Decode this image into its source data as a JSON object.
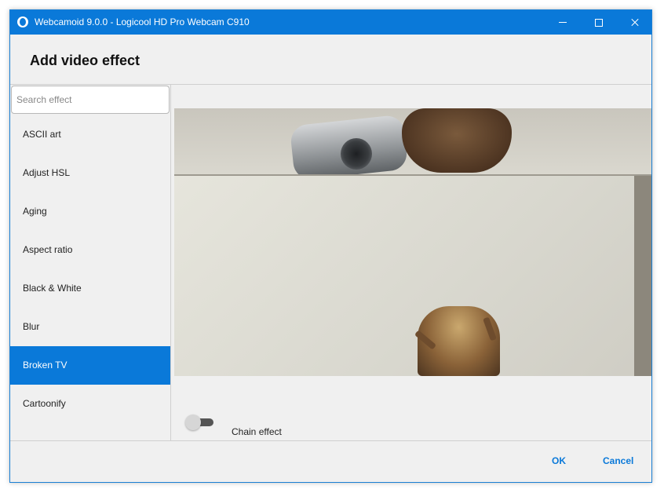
{
  "window": {
    "title": "Webcamoid 9.0.0 - Logicool HD Pro Webcam C910",
    "icon": "webcamoid-app-icon",
    "controls": [
      "minimize-icon",
      "maximize-icon",
      "close-icon"
    ]
  },
  "header": {
    "title": "Add video effect"
  },
  "sidebar": {
    "search": {
      "placeholder": "Search effect",
      "value": ""
    },
    "items": [
      {
        "label": "ASCII art"
      },
      {
        "label": "Adjust HSL"
      },
      {
        "label": "Aging"
      },
      {
        "label": "Aspect ratio"
      },
      {
        "label": "Black & White"
      },
      {
        "label": "Blur"
      },
      {
        "label": "Broken TV",
        "selected": true
      },
      {
        "label": "Cartoonify"
      }
    ],
    "selected_index": 6
  },
  "options": {
    "chain_effect_label": "Chain effect",
    "chain_effect_on": false
  },
  "footer": {
    "ok_label": "OK",
    "cancel_label": "Cancel"
  },
  "colors": {
    "accent": "#0a79d9",
    "window_bg": "#f0f0f0",
    "selected_text": "#ffffff"
  }
}
